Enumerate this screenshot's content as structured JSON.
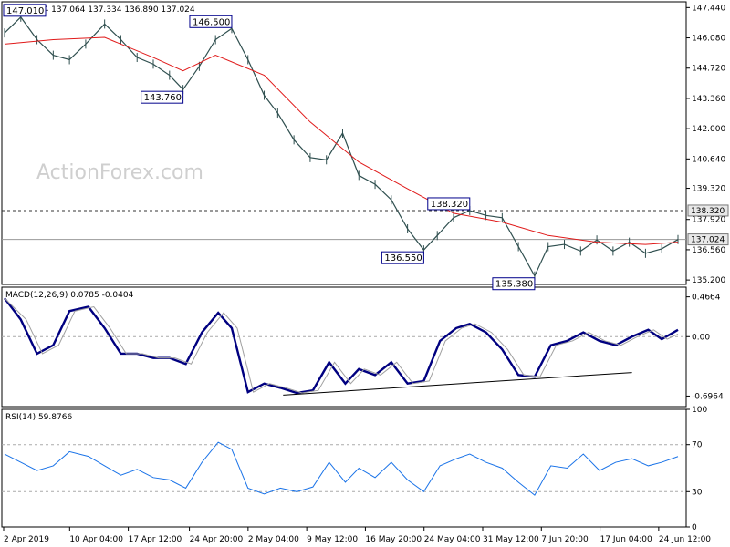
{
  "chart_data": [
    {
      "type": "candlestick",
      "panel": "price",
      "title": "GBPJPY,H4  137.064 137.334 136.890 137.024",
      "watermark": "ActionForex.com",
      "ylim": [
        135.0,
        147.7
      ],
      "yticks": [
        "147.440",
        "146.080",
        "144.720",
        "143.360",
        "142.000",
        "140.640",
        "139.320",
        "137.920",
        "136.560",
        "135.200"
      ],
      "ytick_values": [
        147.44,
        146.08,
        144.72,
        143.36,
        142.0,
        140.64,
        139.32,
        137.92,
        136.56,
        135.2
      ],
      "last_price": {
        "label": "137.024",
        "value": 137.024
      },
      "reference_line": {
        "label": "138.320",
        "value": 138.32,
        "style": "dashed"
      },
      "callouts": [
        {
          "label": "147.010",
          "value": 147.01
        },
        {
          "label": "146.500",
          "value": 146.5
        },
        {
          "label": "143.760",
          "value": 143.76
        },
        {
          "label": "136.550",
          "value": 136.55
        },
        {
          "label": "138.320",
          "value": 138.32
        },
        {
          "label": "135.380",
          "value": 135.38
        }
      ],
      "series": [
        {
          "name": "",
          "color": "#2f4f4f",
          "kind": "bars",
          "x_index": [
            0,
            6,
            12,
            18,
            24,
            30,
            37,
            43,
            49,
            55,
            61,
            66,
            72,
            78,
            84,
            90,
            96,
            101,
            107,
            113,
            119,
            125,
            131,
            137,
            143,
            149,
            155,
            160,
            166,
            172,
            178,
            184,
            190,
            196,
            201,
            207,
            213,
            219,
            225,
            231,
            237,
            243,
            249
          ],
          "values": [
            146.3,
            147.01,
            146.0,
            145.3,
            145.1,
            145.8,
            146.7,
            146.0,
            145.2,
            144.9,
            144.4,
            143.76,
            144.8,
            146.0,
            146.5,
            145.1,
            143.5,
            142.7,
            141.5,
            140.7,
            140.6,
            141.8,
            139.9,
            139.5,
            138.8,
            137.5,
            136.55,
            137.2,
            138.0,
            138.32,
            138.1,
            138.0,
            136.7,
            135.38,
            136.7,
            136.8,
            136.5,
            137.0,
            136.5,
            136.9,
            136.4,
            136.6,
            137.02
          ]
        },
        {
          "name": "",
          "color": "#e01a1a",
          "kind": "line",
          "x_index": [
            0,
            18,
            37,
            55,
            66,
            78,
            96,
            113,
            131,
            149,
            166,
            184,
            201,
            219,
            237,
            249
          ],
          "values": [
            145.8,
            146.0,
            146.1,
            145.2,
            144.6,
            145.3,
            144.4,
            142.3,
            140.5,
            139.3,
            138.2,
            137.8,
            137.2,
            136.9,
            136.8,
            136.9
          ]
        }
      ]
    },
    {
      "type": "line",
      "panel": "macd",
      "title": "MACD(12,26,9) 0.0785 -0.0404",
      "ylim": [
        -0.82,
        0.58
      ],
      "yticks": [
        "0.4664",
        "0.00",
        "-0.6964"
      ],
      "ytick_values": [
        0.4664,
        0.0,
        -0.6964
      ],
      "support_line": {
        "from": {
          "x_index": 103,
          "value": -0.685
        },
        "to": {
          "x_index": 232,
          "value": -0.42
        }
      },
      "series": [
        {
          "name": "",
          "color": "#000080",
          "kind": "line",
          "x_index": [
            0,
            6,
            12,
            18,
            24,
            31,
            37,
            43,
            49,
            55,
            61,
            67,
            73,
            79,
            84,
            90,
            96,
            102,
            108,
            114,
            120,
            126,
            131,
            137,
            143,
            149,
            155,
            161,
            167,
            172,
            178,
            184,
            190,
            196,
            202,
            208,
            214,
            220,
            226,
            232,
            238,
            243,
            249
          ],
          "values": [
            0.45,
            0.2,
            -0.2,
            -0.1,
            0.3,
            0.35,
            0.1,
            -0.2,
            -0.2,
            -0.25,
            -0.25,
            -0.32,
            0.05,
            0.28,
            0.1,
            -0.65,
            -0.55,
            -0.6,
            -0.66,
            -0.63,
            -0.3,
            -0.55,
            -0.38,
            -0.45,
            -0.3,
            -0.55,
            -0.52,
            -0.05,
            0.1,
            0.15,
            0.05,
            -0.15,
            -0.45,
            -0.47,
            -0.1,
            -0.05,
            0.05,
            -0.05,
            -0.1,
            0.0,
            0.08,
            -0.03,
            0.08
          ]
        },
        {
          "name": "",
          "color": "#a0a0a0",
          "kind": "line",
          "x_index": [
            0,
            8,
            14,
            20,
            26,
            33,
            39,
            45,
            51,
            57,
            63,
            69,
            75,
            81,
            86,
            92,
            98,
            104,
            110,
            116,
            122,
            128,
            133,
            139,
            145,
            151,
            157,
            163,
            169,
            174,
            180,
            186,
            192,
            198,
            204,
            210,
            216,
            222,
            228,
            234,
            240,
            245,
            249
          ],
          "values": [
            0.45,
            0.2,
            -0.2,
            -0.1,
            0.3,
            0.35,
            0.1,
            -0.2,
            -0.2,
            -0.25,
            -0.25,
            -0.32,
            0.05,
            0.28,
            0.1,
            -0.65,
            -0.55,
            -0.6,
            -0.66,
            -0.63,
            -0.3,
            -0.55,
            -0.38,
            -0.45,
            -0.3,
            -0.55,
            -0.52,
            -0.05,
            0.1,
            0.15,
            0.05,
            -0.15,
            -0.45,
            -0.47,
            -0.1,
            -0.05,
            0.05,
            -0.05,
            -0.1,
            0.0,
            0.08,
            -0.03,
            0.03
          ]
        }
      ]
    },
    {
      "type": "line",
      "panel": "rsi",
      "title": "RSI(14) 59.8766",
      "ylim": [
        0,
        100
      ],
      "yticks": [
        "100",
        "70",
        "30",
        "0"
      ],
      "ytick_values": [
        100,
        70,
        30,
        0
      ],
      "levels": [
        70,
        30
      ],
      "series": [
        {
          "name": "",
          "color": "#1a73e8",
          "kind": "line",
          "x_index": [
            0,
            6,
            12,
            18,
            24,
            31,
            37,
            43,
            49,
            55,
            61,
            67,
            73,
            79,
            84,
            90,
            96,
            102,
            108,
            114,
            120,
            126,
            131,
            137,
            143,
            149,
            155,
            161,
            167,
            172,
            178,
            184,
            190,
            196,
            202,
            208,
            214,
            220,
            226,
            232,
            238,
            243,
            249
          ],
          "values": [
            62,
            55,
            48,
            52,
            64,
            60,
            52,
            44,
            49,
            42,
            40,
            33,
            55,
            72,
            66,
            33,
            28,
            33,
            30,
            34,
            55,
            38,
            50,
            42,
            55,
            40,
            30,
            52,
            58,
            62,
            55,
            50,
            38,
            27,
            52,
            50,
            62,
            48,
            55,
            58,
            52,
            55,
            59.88
          ]
        }
      ]
    }
  ],
  "x_axis": {
    "count": 250,
    "ticks": [
      {
        "label": "2 Apr 2019",
        "x_index": 0
      },
      {
        "label": "10 Apr 04:00",
        "x_index": 27
      },
      {
        "label": "17 Apr 12:00",
        "x_index": 51
      },
      {
        "label": "24 Apr 20:00",
        "x_index": 76
      },
      {
        "label": "2 May 04:00",
        "x_index": 100
      },
      {
        "label": "9 May 12:00",
        "x_index": 124
      },
      {
        "label": "16 May 20:00",
        "x_index": 148
      },
      {
        "label": "24 May 04:00",
        "x_index": 172
      },
      {
        "label": "31 May 12:00",
        "x_index": 196
      },
      {
        "label": "7 Jun 20:00",
        "x_index": 220
      },
      {
        "label": "17 Jun 04:00",
        "x_index": 244
      },
      {
        "label": "24 Jun 12:00",
        "x_index": 268
      }
    ]
  }
}
